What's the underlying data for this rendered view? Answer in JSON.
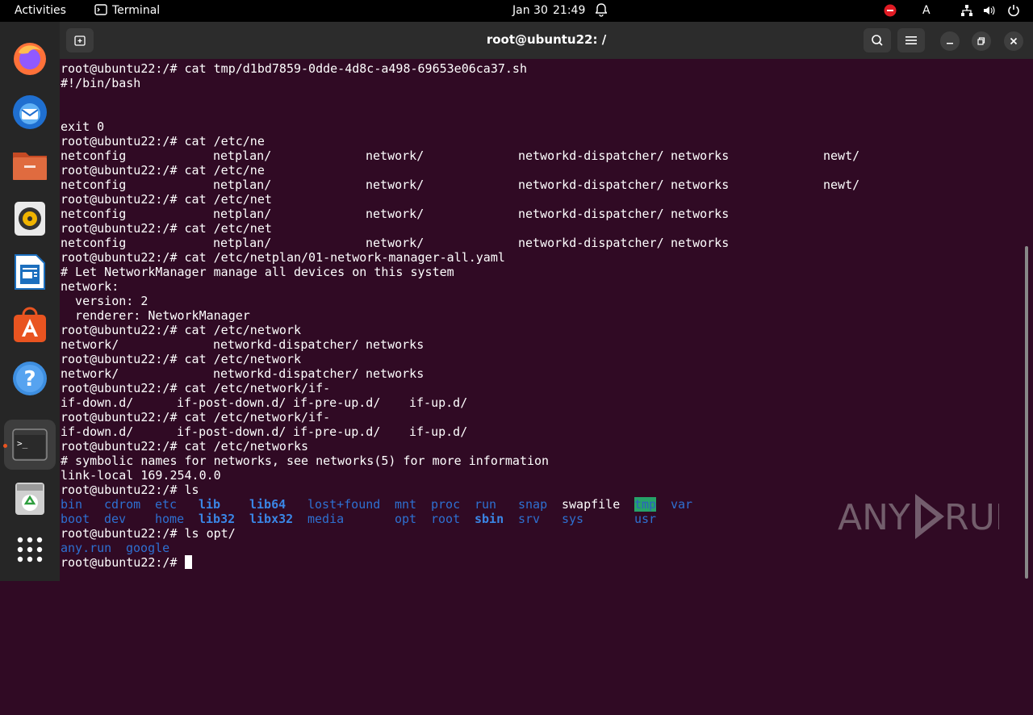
{
  "topbar": {
    "activities": "Activities",
    "app_name": "Terminal",
    "date": "Jan 30",
    "time": "21:49",
    "keyboard_layout": "A"
  },
  "dock": {
    "items": [
      {
        "icon": "firefox-icon",
        "label": "Firefox"
      },
      {
        "icon": "thunderbird-icon",
        "label": "Thunderbird"
      },
      {
        "icon": "files-icon",
        "label": "Files"
      },
      {
        "icon": "rhythmbox-icon",
        "label": "Rhythmbox"
      },
      {
        "icon": "libreoffice-writer-icon",
        "label": "LibreOffice Writer"
      },
      {
        "icon": "app-center-icon",
        "label": "Ubuntu Software"
      },
      {
        "icon": "help-icon",
        "label": "Help"
      },
      {
        "icon": "terminal-icon",
        "label": "Terminal"
      },
      {
        "icon": "trash-icon",
        "label": "Trash"
      },
      {
        "icon": "show-apps-icon",
        "label": "Show Applications"
      }
    ]
  },
  "window": {
    "title": "root@ubuntu22: /"
  },
  "terminal": {
    "lines": [
      "root@ubuntu22:/# cat tmp/d1bd7859-0dde-4d8c-a498-69653e06ca37.sh",
      "#!/bin/bash",
      "",
      "",
      "exit 0",
      "root@ubuntu22:/# cat /etc/ne",
      "root@ubuntu22:/# cat /etc/ne",
      "root@ubuntu22:/# cat /etc/net",
      "root@ubuntu22:/# cat /etc/net",
      "root@ubuntu22:/# cat /etc/netplan/01-network-manager-all.yaml",
      "# Let NetworkManager manage all devices on this system",
      "network:",
      "  version: 2",
      "  renderer: NetworkManager",
      "root@ubuntu22:/# cat /etc/network",
      "root@ubuntu22:/# cat /etc/network",
      "root@ubuntu22:/# cat /etc/network/if-",
      "root@ubuntu22:/# cat /etc/network/if-",
      "root@ubuntu22:/# cat /etc/networks",
      "# symbolic names for networks, see networks(5) for more information",
      "link-local 169.254.0.0",
      "root@ubuntu22:/# ls",
      "root@ubuntu22:/# ls opt/",
      "root@ubuntu22:/# "
    ],
    "completions_etc_ne": [
      "netconfig",
      "netplan/",
      "network/",
      "networkd-dispatcher/",
      "networks",
      "newt/"
    ],
    "completions_etc_net": [
      "netconfig",
      "netplan/",
      "network/",
      "networkd-dispatcher/",
      "networks"
    ],
    "completions_etc_network": [
      "network/",
      "networkd-dispatcher/",
      "networks"
    ],
    "completions_if": [
      "if-down.d/",
      "if-post-down.d/",
      "if-pre-up.d/",
      "if-up.d/"
    ],
    "ls_root": {
      "row1": [
        "bin",
        "cdrom",
        "etc",
        "lib",
        "lib64",
        "lost+found",
        "mnt",
        "proc",
        "run",
        "snap",
        "swapfile",
        "tmp",
        "var"
      ],
      "row2": [
        "boot",
        "dev",
        "home",
        "lib32",
        "libx32",
        "media",
        "opt",
        "root",
        "sbin",
        "srv",
        "sys",
        "usr"
      ]
    },
    "ls_opt": [
      "any.run",
      "google"
    ]
  },
  "watermark": {
    "text": "ANY RUN"
  },
  "colors": {
    "terminal_bg": "#300a24",
    "dir_blue": "#2e70d1",
    "link_blue": "#3a86e6",
    "tmp_bg": "#26a269",
    "accent": "#e95420"
  }
}
